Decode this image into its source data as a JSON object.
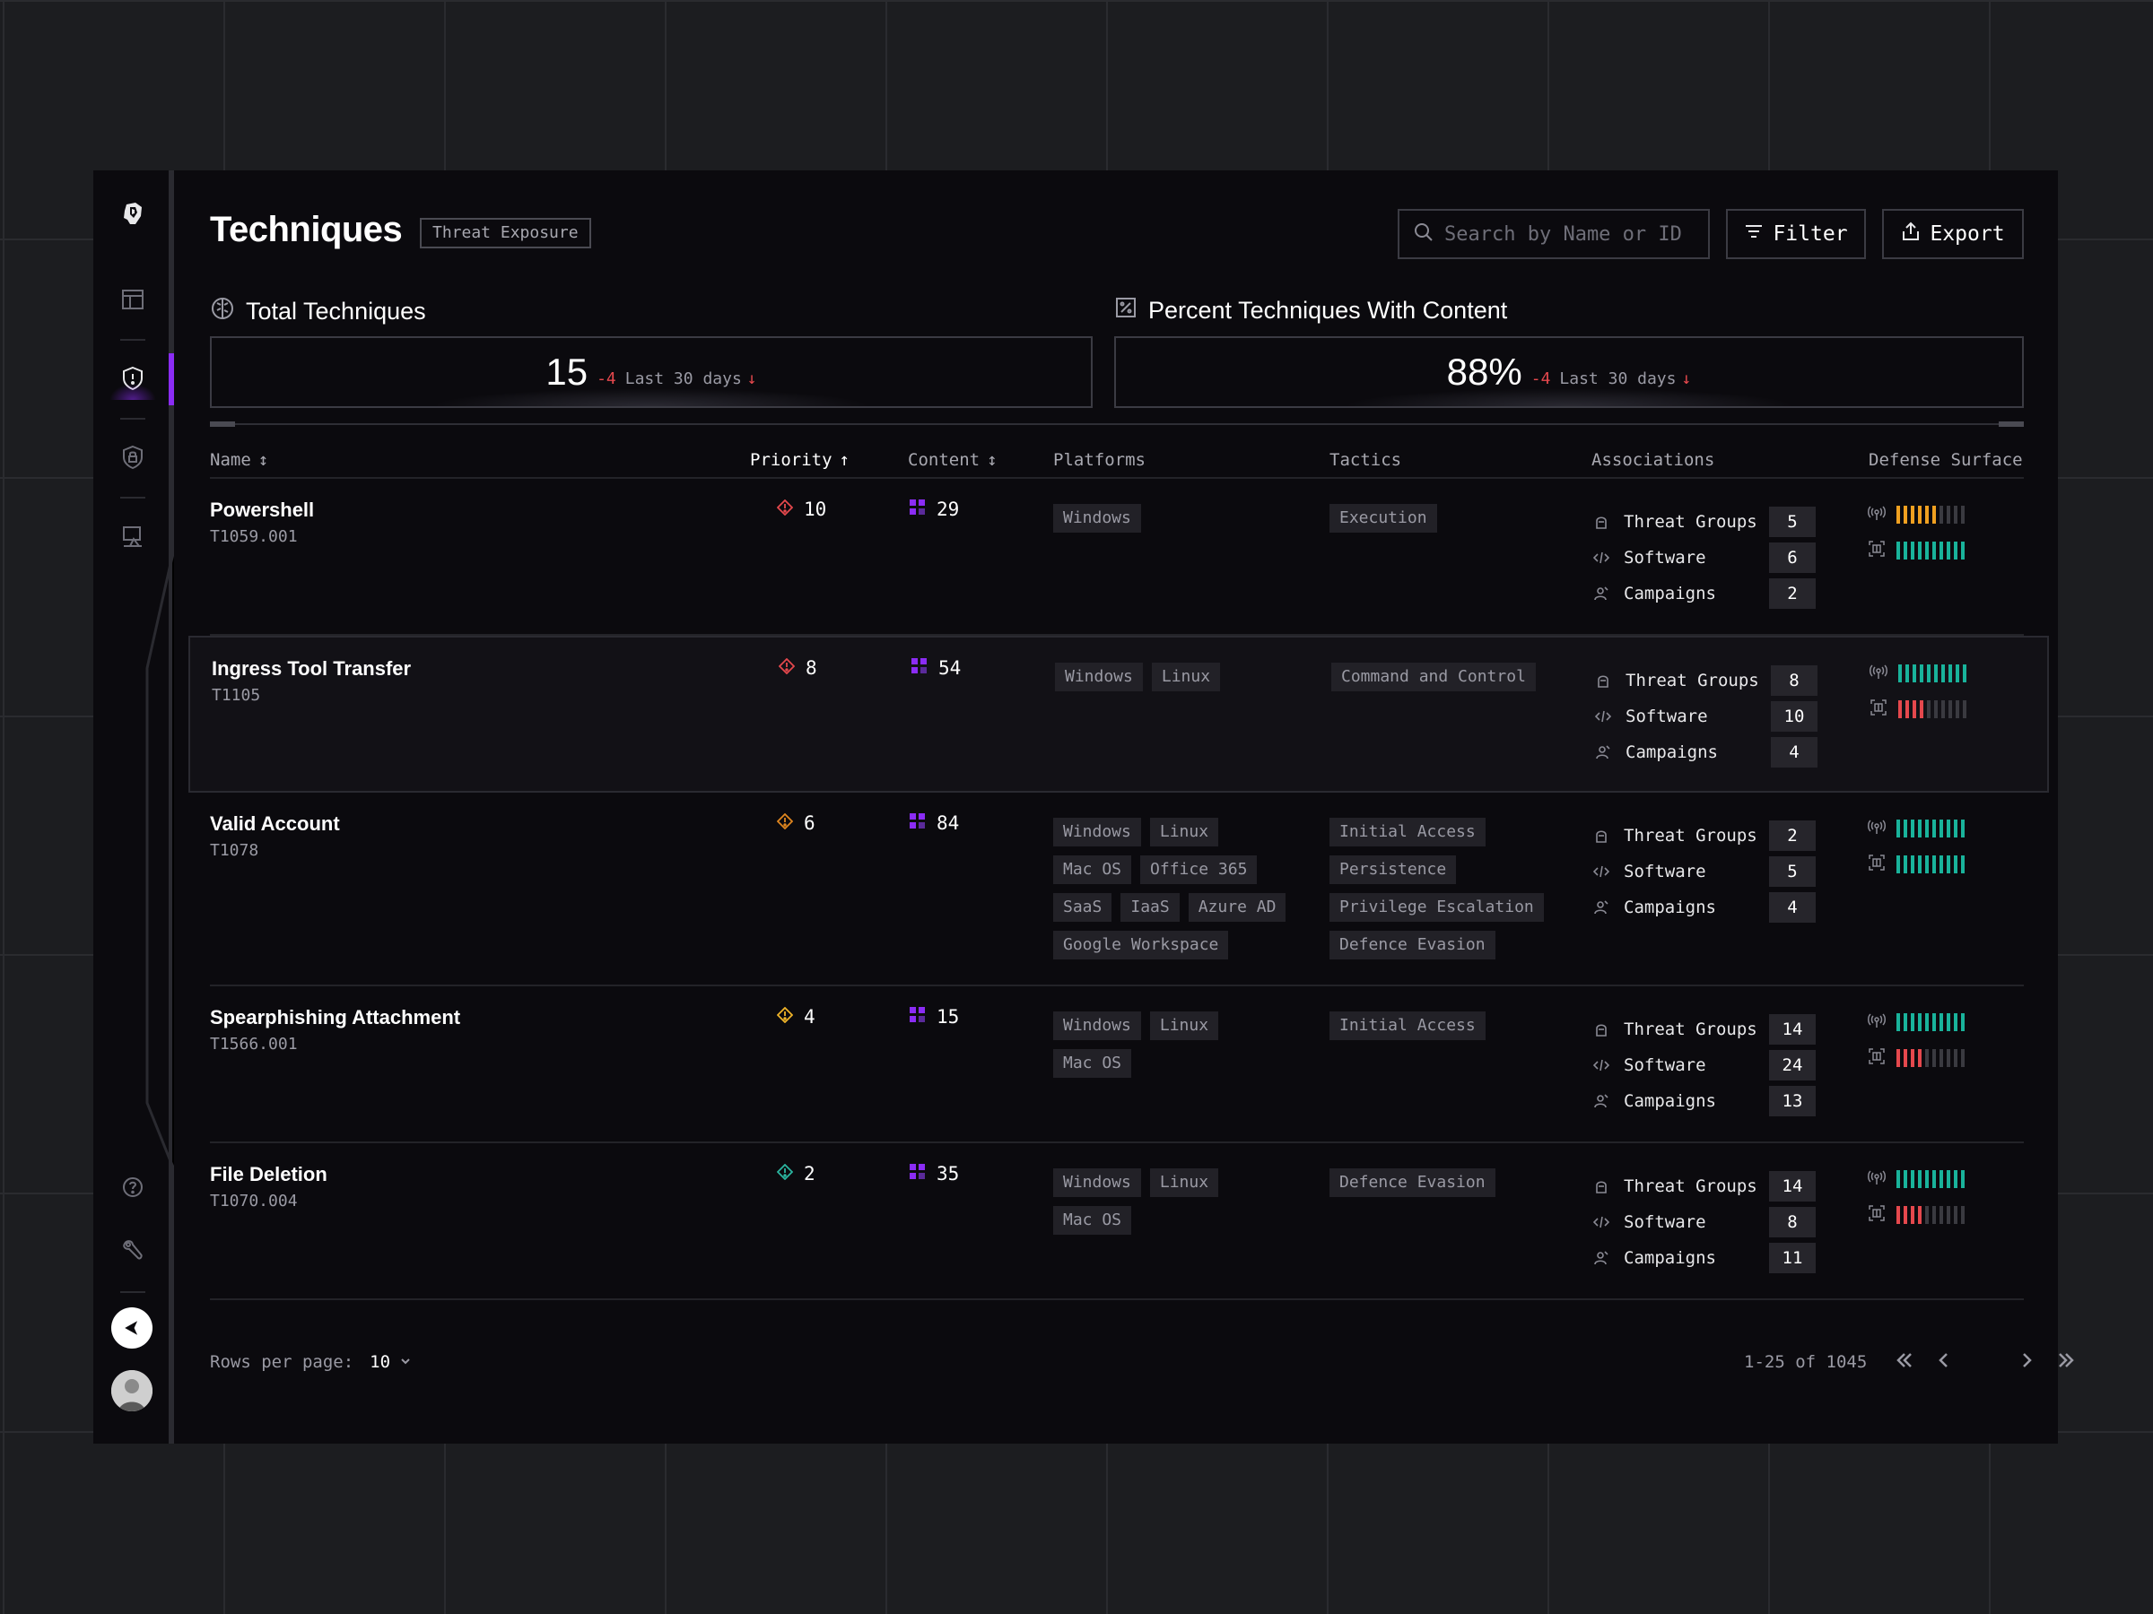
{
  "colors": {
    "accent": "#8b2cf5",
    "priority_high": "#e5484d",
    "priority_med": "#e0861f",
    "priority_low": "#f0b429",
    "priority_lowest": "#2bb5a0",
    "bar_green": "#19b39b",
    "bar_orange": "#f0a020",
    "bar_red": "#e5484d",
    "bar_off": "#3a3a40"
  },
  "sidebar": {
    "items": [
      {
        "icon": "logo-icon"
      },
      {
        "icon": "layout-icon"
      },
      {
        "icon": "shield-alert-icon",
        "active": true
      },
      {
        "icon": "shield-lock-icon"
      },
      {
        "icon": "monitor-icon"
      },
      {
        "icon": "help-icon"
      },
      {
        "icon": "wrench-icon"
      },
      {
        "icon": "collapse-icon"
      },
      {
        "icon": "avatar"
      }
    ]
  },
  "header": {
    "title": "Techniques",
    "badge": "Threat Exposure",
    "search_placeholder": "Search by Name or ID",
    "filter_label": "Filter",
    "export_label": "Export"
  },
  "stats": {
    "total": {
      "label": "Total Techniques",
      "value": "15",
      "delta": "-4",
      "period": "Last 30 days"
    },
    "percent": {
      "label": "Percent Techniques With Content",
      "value": "88%",
      "delta": "-4",
      "period": "Last 30 days"
    }
  },
  "table": {
    "columns": {
      "name": "Name",
      "priority": "Priority",
      "content": "Content",
      "platforms": "Platforms",
      "tactics": "Tactics",
      "associations": "Associations",
      "defense_surface": "Defense Surface"
    },
    "association_labels": [
      "Threat Groups",
      "Software",
      "Campaigns"
    ],
    "rows": [
      {
        "name": "Powershell",
        "id": "T1059.001",
        "priority": "10",
        "priority_level": "high",
        "content": "29",
        "platforms": [
          "Windows"
        ],
        "tactics": [
          "Execution"
        ],
        "threat_groups": "5",
        "software": "6",
        "campaigns": "2",
        "surface": [
          {
            "level": 6,
            "color": "orange"
          },
          {
            "level": 10,
            "color": "green"
          }
        ]
      },
      {
        "name": "Ingress Tool Transfer",
        "id": "T1105",
        "priority": "8",
        "priority_level": "high",
        "content": "54",
        "platforms": [
          "Windows",
          "Linux"
        ],
        "tactics": [
          "Command and Control"
        ],
        "threat_groups": "8",
        "software": "10",
        "campaigns": "4",
        "surface": [
          {
            "level": 10,
            "color": "green"
          },
          {
            "level": 4,
            "color": "red"
          }
        ]
      },
      {
        "name": "Valid Account",
        "id": "T1078",
        "priority": "6",
        "priority_level": "med",
        "content": "84",
        "platforms": [
          "Windows",
          "Linux",
          "Mac OS",
          "Office 365",
          "SaaS",
          "IaaS",
          "Azure AD",
          "Google Workspace"
        ],
        "tactics": [
          "Initial Access",
          "Persistence",
          "Privilege Escalation",
          "Defence Evasion"
        ],
        "threat_groups": "2",
        "software": "5",
        "campaigns": "4",
        "surface": [
          {
            "level": 10,
            "color": "green"
          },
          {
            "level": 10,
            "color": "green"
          }
        ]
      },
      {
        "name": "Spearphishing Attachment",
        "id": "T1566.001",
        "priority": "4",
        "priority_level": "low",
        "content": "15",
        "platforms": [
          "Windows",
          "Linux",
          "Mac OS"
        ],
        "tactics": [
          "Initial Access"
        ],
        "threat_groups": "14",
        "software": "24",
        "campaigns": "13",
        "surface": [
          {
            "level": 10,
            "color": "green"
          },
          {
            "level": 4,
            "color": "red"
          }
        ]
      },
      {
        "name": "File Deletion",
        "id": "T1070.004",
        "priority": "2",
        "priority_level": "lowest",
        "content": "35",
        "platforms": [
          "Windows",
          "Linux",
          "Mac OS"
        ],
        "tactics": [
          "Defence Evasion"
        ],
        "threat_groups": "14",
        "software": "8",
        "campaigns": "11",
        "surface": [
          {
            "level": 10,
            "color": "green"
          },
          {
            "level": 4,
            "color": "red"
          }
        ]
      }
    ]
  },
  "footer": {
    "rows_per_page_label": "Rows per page:",
    "rows_per_page_value": "10",
    "range": "1-25 of 1045"
  }
}
